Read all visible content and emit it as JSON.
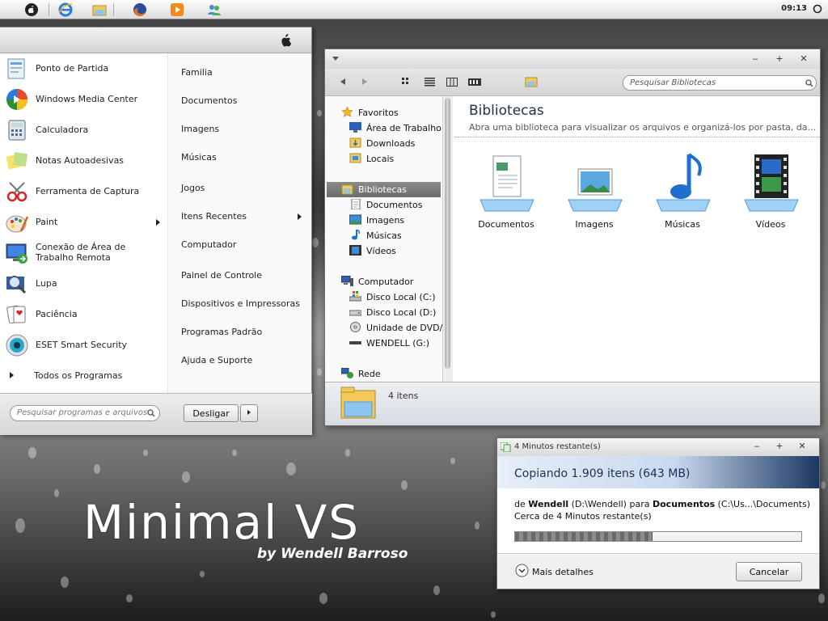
{
  "taskbar": {
    "clock": "09:13"
  },
  "start_menu": {
    "programs": [
      {
        "label": "Ponto de Partida",
        "icon": "getting-started-icon"
      },
      {
        "label": "Windows Media Center",
        "icon": "media-center-icon"
      },
      {
        "label": "Calculadora",
        "icon": "calculator-icon"
      },
      {
        "label": "Notas Autoadesivas",
        "icon": "sticky-notes-icon"
      },
      {
        "label": "Ferramenta de Captura",
        "icon": "snipping-tool-icon"
      },
      {
        "label": "Paint",
        "icon": "paint-icon"
      },
      {
        "label": "Conexão de Área de Trabalho Remota",
        "line1": "Conexão de Área de",
        "line2": "Trabalho Remota",
        "icon": "remote-desktop-icon"
      },
      {
        "label": "Lupa",
        "icon": "magnifier-icon"
      },
      {
        "label": "Paciência",
        "icon": "solitaire-icon"
      },
      {
        "label": "ESET Smart Security",
        "icon": "eset-icon"
      }
    ],
    "all_programs": "Todos os Programas",
    "right_items": [
      "Familia",
      "Documentos",
      "Imagens",
      "Músicas",
      "Jogos",
      "Itens Recentes",
      "Computador",
      "Painel de Controle",
      "Dispositivos e Impressoras",
      "Programas Padrão",
      "Ajuda e Suporte"
    ],
    "search_placeholder": "Pesquisar programas e arquivos",
    "shutdown_label": "Desligar"
  },
  "explorer": {
    "search_placeholder": "Pesquisar Bibliotecas",
    "nav": {
      "favorites": {
        "label": "Favoritos",
        "items": [
          "Área de Trabalho",
          "Downloads",
          "Locais"
        ]
      },
      "libraries": {
        "label": "Bibliotecas",
        "items": [
          "Documentos",
          "Imagens",
          "Músicas",
          "Vídeos"
        ]
      },
      "computer": {
        "label": "Computador",
        "items": [
          "Disco Local (C:)",
          "Disco Local (D:)",
          "Unidade de DVD/",
          "WENDELL (G:)"
        ]
      },
      "network": {
        "label": "Rede"
      }
    },
    "title": "Bibliotecas",
    "subtitle": "Abra uma biblioteca para visualizar os arquivos e organizá-los por pasta, da...",
    "libraries": [
      "Documentos",
      "Imagens",
      "Músicas",
      "Vídeos"
    ],
    "status": "4 itens"
  },
  "copy_dialog": {
    "title": "4 Minutos restante(s)",
    "heading": "Copiando 1.909 itens (643 MB)",
    "from_prefix": "de",
    "from_name": "Wendell",
    "from_path": "(D:\\Wendell)",
    "to_word": "para",
    "to_name": "Documentos",
    "to_path": "(C:\\Us...\\Documents)",
    "remaining": "Cerca de 4 Minutos restante(s)",
    "progress_percent": 48,
    "more_details": "Mais detalhes",
    "cancel": "Cancelar"
  },
  "wallpaper": {
    "title": "Minimal VS",
    "byline": "by Wendell Barroso"
  }
}
